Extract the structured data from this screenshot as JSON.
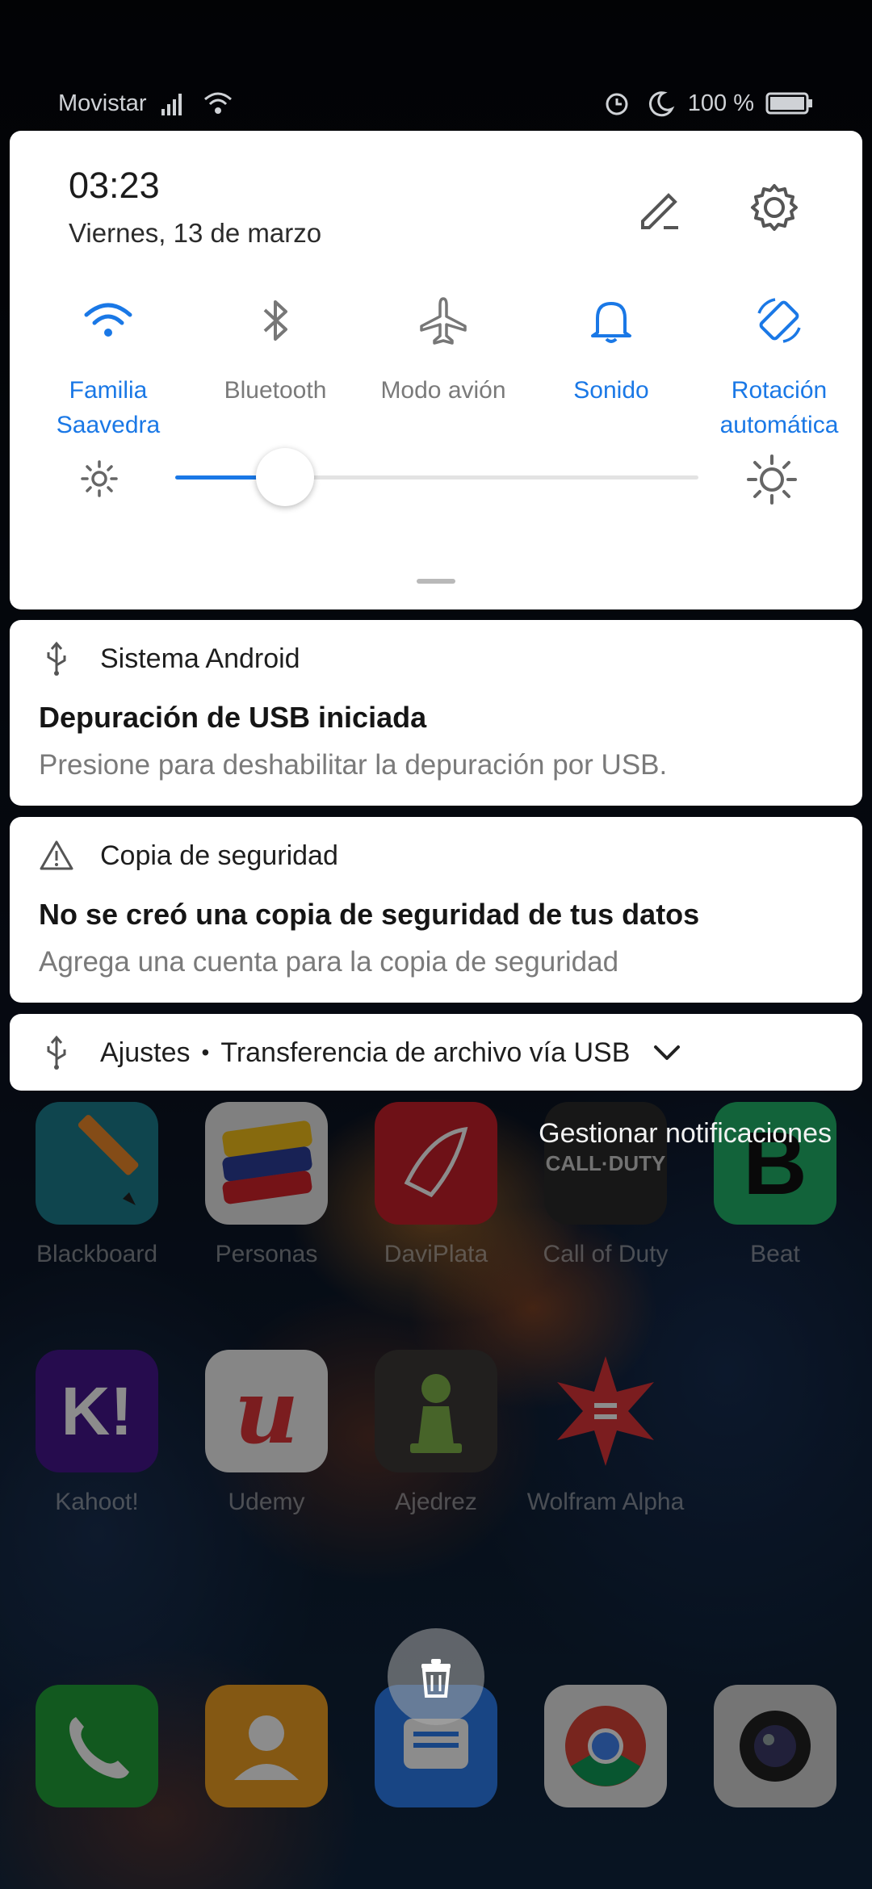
{
  "status_bar": {
    "carrier": "Movistar",
    "battery": "100 %"
  },
  "quick_settings": {
    "time": "03:23",
    "date": "Viernes, 13 de marzo",
    "toggles": [
      {
        "label": "Familia Saavedra",
        "icon": "wifi-icon",
        "state": "on"
      },
      {
        "label": "Bluetooth",
        "icon": "bluetooth-icon",
        "state": "off"
      },
      {
        "label": "Modo avión",
        "icon": "airplane-icon",
        "state": "off"
      },
      {
        "label": "Sonido",
        "icon": "bell-icon",
        "state": "on"
      },
      {
        "label": "Rotación automática",
        "icon": "rotate-icon",
        "state": "on"
      }
    ],
    "brightness_level": 0.21
  },
  "notifications": [
    {
      "app": "Sistema Android",
      "icon": "usb-icon",
      "title": "Depuración de USB iniciada",
      "body": "Presione para deshabilitar la depuración por USB."
    },
    {
      "app": "Copia de seguridad",
      "icon": "warning-icon",
      "title": "No se creó una copia de seguridad de tus datos",
      "body": "Agrega una cuenta para la copia de seguridad"
    },
    {
      "app": "Ajustes",
      "icon": "usb-icon",
      "summary": "Transferencia de archivo vía USB"
    }
  ],
  "manage_notifications": "Gestionar notificaciones",
  "home_apps": [
    {
      "name": "Blackboard",
      "color": "#1d7f8f"
    },
    {
      "name": "Personas",
      "color": "#e9e9e9"
    },
    {
      "name": "DaviPlata",
      "color": "#c8202a"
    },
    {
      "name": "Call of Duty",
      "color": "#2b2b2b"
    },
    {
      "name": "Beat",
      "color": "#21b56a"
    },
    {
      "name": "Kahoot!",
      "color": "#46178f"
    },
    {
      "name": "Udemy",
      "color": "#f4f4f4"
    },
    {
      "name": "Ajedrez",
      "color": "#3c3a37"
    },
    {
      "name": "Wolfram Alpha",
      "color": "transparent"
    }
  ],
  "colors": {
    "accent": "#1a78e6",
    "panel": "#ffffff",
    "text_muted": "#7a7a7a"
  }
}
